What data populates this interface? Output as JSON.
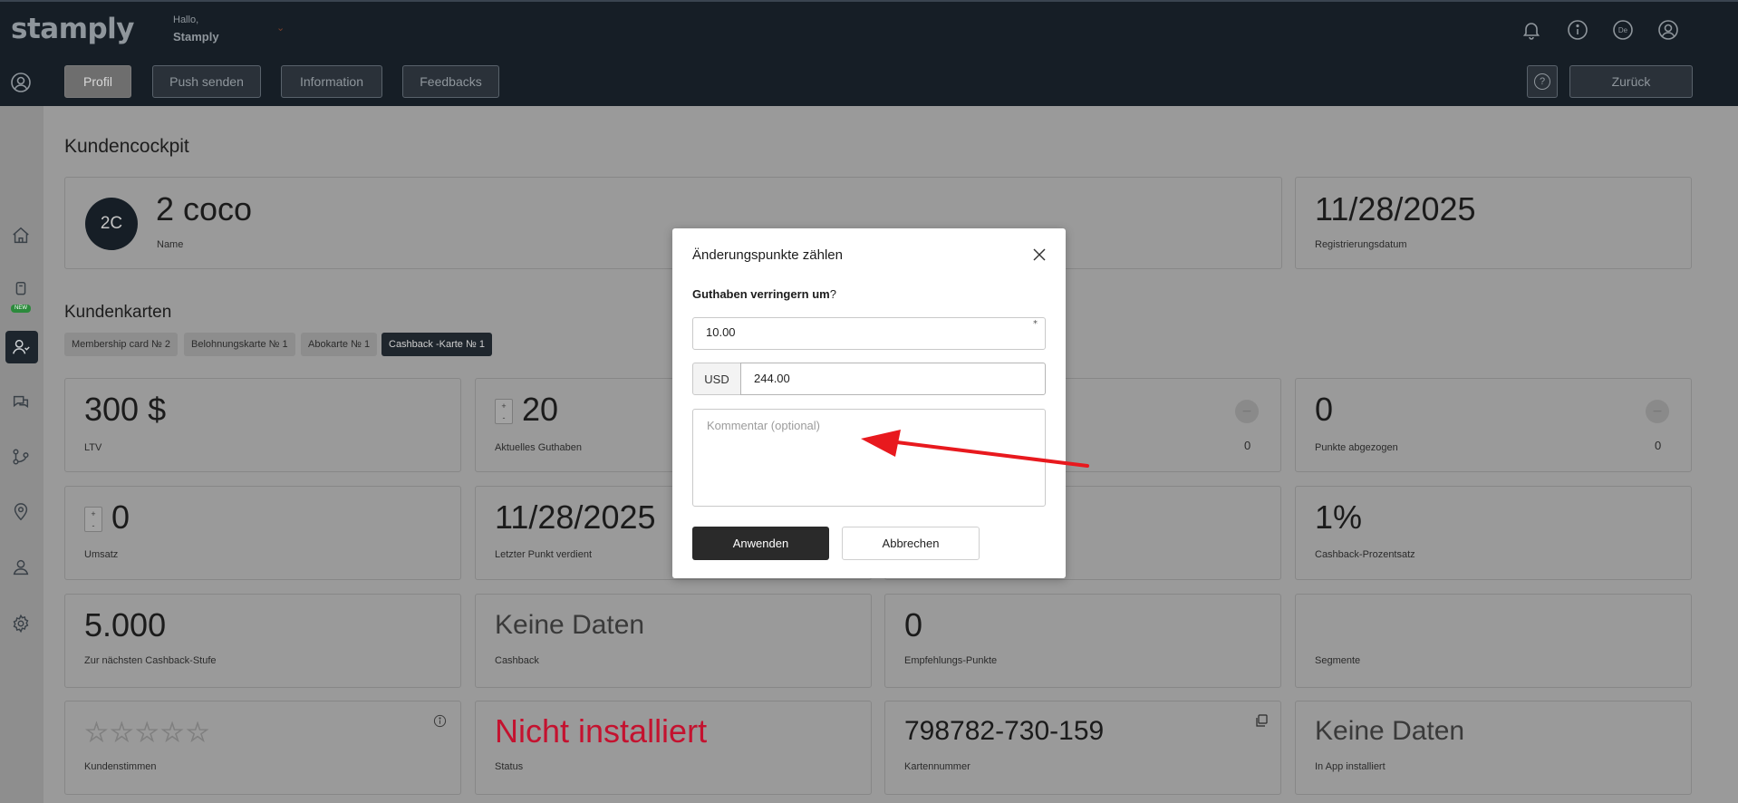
{
  "header": {
    "logo": "stamply",
    "greeting": "Hallo,",
    "user_name": "Stamply",
    "language_badge": "De",
    "icons": [
      "bell-icon",
      "info-icon",
      "language-icon",
      "user-icon"
    ]
  },
  "nav": {
    "tabs": [
      "Profil",
      "Push senden",
      "Information",
      "Feedbacks"
    ],
    "active_tab": "Profil",
    "help": "?",
    "back": "Zurück"
  },
  "sidebar": {
    "items": [
      "home-icon",
      "device-icon",
      "customers-icon",
      "chat-icon",
      "flow-icon",
      "location-icon",
      "user-icon",
      "settings-icon"
    ],
    "new_badge": "NEW",
    "active_item": "customers-icon"
  },
  "page": {
    "title": "Kundencockpit",
    "customer": {
      "initials": "2C",
      "name": "2 coco",
      "name_label": "Name",
      "reg_date": "11/28/2025",
      "reg_label": "Registrierungsdatum"
    },
    "cards_title": "Kundenkarten",
    "card_tabs": [
      "Membership card № 2",
      "Belohnungskarte № 1",
      "Abokarte № 1",
      "Cashback -Karte № 1"
    ],
    "active_card_tab": "Cashback -Karte № 1",
    "stats": {
      "ltv": {
        "value": "300 $",
        "label": "LTV"
      },
      "balance": {
        "value": "20",
        "label": "Aktuelles Guthaben"
      },
      "points_col3": {
        "value": "0"
      },
      "points_deducted": {
        "value": "0",
        "label": "Punkte abgezogen",
        "count": "0"
      },
      "revenue": {
        "value": "0",
        "label": "Umsatz"
      },
      "last_point": {
        "value": "11/28/2025",
        "label": "Letzter Punkt verdient"
      },
      "cashback_pct": {
        "value": "1%",
        "label": "Cashback-Prozentsatz"
      },
      "next_tier": {
        "value": "5.000",
        "label": "Zur nächsten Cashback-Stufe"
      },
      "cashback": {
        "value": "Keine Daten",
        "label": "Cashback"
      },
      "referral": {
        "value": "0",
        "label": "Empfehlungs-Punkte"
      },
      "segments": {
        "value": "",
        "label": "Segmente"
      },
      "rating": {
        "label": "Kundenstimmen",
        "stars": 0
      },
      "status": {
        "value": "Nicht installiert",
        "label": "Status"
      },
      "card_number": {
        "value": "798782-730-159",
        "label": "Kartennummer"
      },
      "in_app": {
        "value": "Keine Daten",
        "label": "In App installiert"
      }
    }
  },
  "modal": {
    "title": "Änderungspunkte zählen",
    "subtitle_bold": "Guthaben verringern um",
    "subtitle_mark": "?",
    "amount": "10.00",
    "required_mark": "*",
    "currency": "USD",
    "currency_value": "244.00",
    "comment_placeholder": "Kommentar (optional)",
    "apply": "Anwenden",
    "cancel": "Abbrechen"
  },
  "colors": {
    "header_bg": "#161e26",
    "status_red": "#c4122f",
    "annotation_arrow": "#e8191e"
  }
}
